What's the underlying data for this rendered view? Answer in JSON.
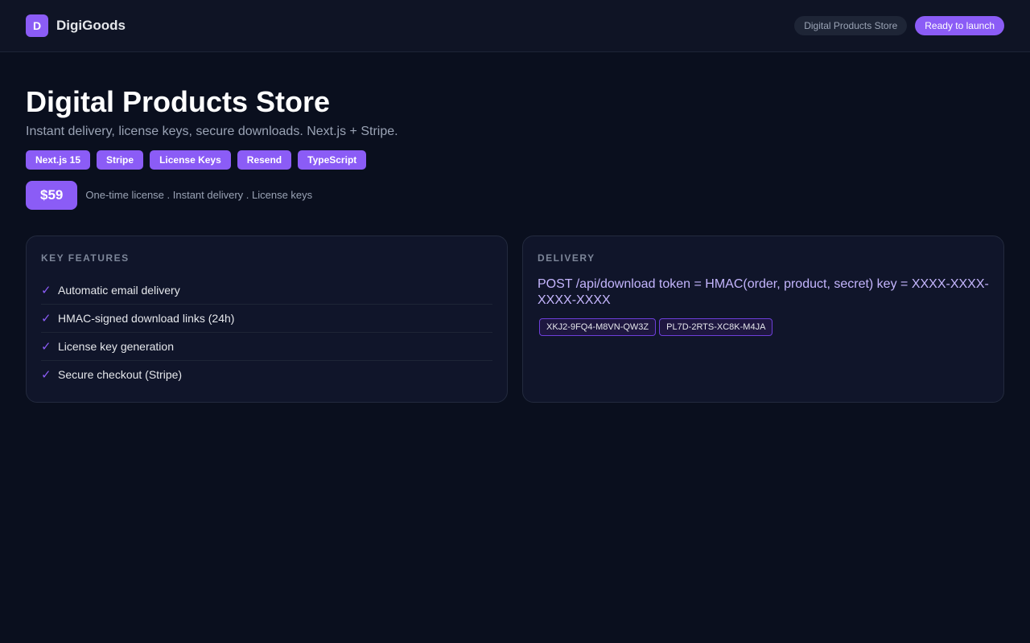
{
  "header": {
    "logo_letter": "D",
    "brand": "DigiGoods",
    "nav_pill": "Digital Products Store",
    "status_pill": "Ready to launch"
  },
  "hero": {
    "title": "Digital Products Store",
    "subtitle": "Instant delivery, license keys, secure downloads. Next.js + Stripe.",
    "tags": [
      "Next.js 15",
      "Stripe",
      "License Keys",
      "Resend",
      "TypeScript"
    ],
    "price": "$59",
    "price_note": "One-time license . Instant delivery . License keys"
  },
  "features_card": {
    "heading": "KEY FEATURES",
    "check_glyph": "✓",
    "items": [
      "Automatic email delivery",
      "HMAC-signed download links (24h)",
      "License key generation",
      "Secure checkout (Stripe)"
    ]
  },
  "delivery_card": {
    "heading": "DELIVERY",
    "text": "POST /api/download token = HMAC(order, product, secret) key = XXXX-XXXX-XXXX-XXXX",
    "keys": [
      "XKJ2-9FQ4-M8VN-QW3Z",
      "PL7D-2RTS-XC8K-M4JA"
    ]
  },
  "colors": {
    "accent": "#8b5cf6",
    "background": "#0a0f1e",
    "card": "#10152a"
  }
}
